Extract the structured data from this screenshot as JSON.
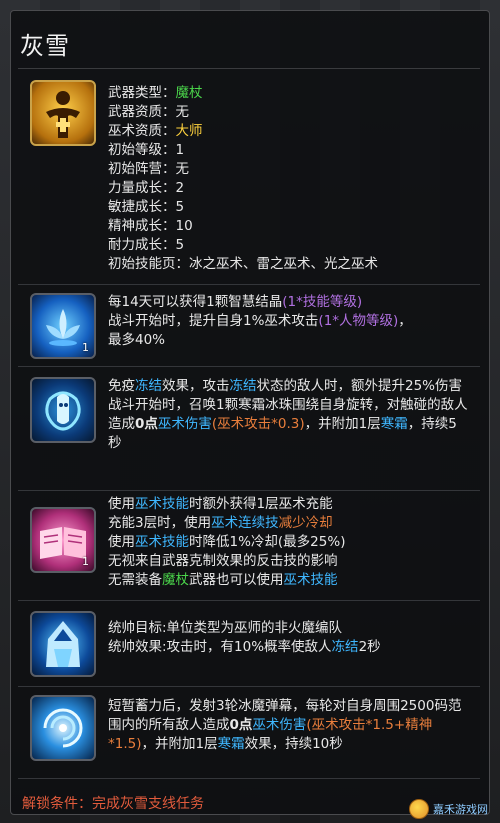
{
  "header": {
    "title": "灰雪"
  },
  "hero": {
    "weapon_type_label": "武器类型：",
    "weapon_type_value": "魔杖",
    "weapon_aptitude_label": "武器资质：",
    "weapon_aptitude_value": "无",
    "sorcery_aptitude_label": "巫术资质：",
    "sorcery_aptitude_value": "大师",
    "initial_level_label": "初始等级：",
    "initial_level_value": "1",
    "initial_camp_label": "初始阵营：",
    "initial_camp_value": "无",
    "strength_growth_label": "力量成长：",
    "strength_growth_value": "2",
    "agility_growth_label": "敏捷成长：",
    "agility_growth_value": "5",
    "spirit_growth_label": "精神成长：",
    "spirit_growth_value": "10",
    "stamina_growth_label": "耐力成长：",
    "stamina_growth_value": "5",
    "initial_skills_label": "初始技能页：",
    "initial_skills_value": "冰之巫术、雷之巫术、光之巫术"
  },
  "skills": [
    {
      "icon": "ice-lotus-icon",
      "level": "1",
      "line1_a": "每14天可以获得1颗智慧结晶",
      "line1_b": "(1*技能等级)",
      "line2_a": "战斗开始时，提升自身1%巫术攻击",
      "line2_b": "(1*人物等级)",
      "line2_c": "，",
      "line3": "最多40%"
    },
    {
      "icon": "frost-orb-icon",
      "p1": "免疫",
      "p2": "冻结",
      "p3": "效果，攻击",
      "p4": "冻结",
      "p5": "状态的敌人时，额外提升25%伤害",
      "p6": "战斗开始时，召唤1颗寒霜冰珠围绕自身旋转，对触碰的敌人造成",
      "p7": "0点",
      "p8": "巫术伤害",
      "p9": "(巫术攻击*0.3)",
      "p10": "，并附加1层",
      "p11": "寒霜",
      "p12": "，持续5秒"
    },
    {
      "icon": "spellbook-icon",
      "level": "1",
      "line1_a": "使用",
      "line1_b": "巫术技能",
      "line1_c": "时额外获得1层巫术充能",
      "line2_a": "充能3层时，使用",
      "line2_b": "巫术连续技",
      "line2_c": "减少冷却",
      "line3_a": "使用",
      "line3_b": "巫术技能",
      "line3_c": "时降低1%冷却(最多25%)",
      "line4": "无视来自武器克制效果的反击技的影响",
      "line5_a": "无需装备",
      "line5_b": "魔杖",
      "line5_c": "武器也可以使用",
      "line5_d": "巫术技能"
    },
    {
      "icon": "ice-mage-icon",
      "line1": "统帅目标:单位类型为巫师的非火魔编队",
      "line2_a": "统帅效果:攻击时，有10%概率使敌人",
      "line2_b": "冻结",
      "line2_c": "2秒"
    },
    {
      "icon": "ice-vortex-icon",
      "p1": "短暂蓄力后，发射3轮冰魔弹幕，每轮对自身周围2500码范围内的所有敌人造成",
      "p2": "0点",
      "p3": "巫术伤害",
      "p4": "(巫术攻击*1.5+精神*1.5)",
      "p5": "，并附加1层",
      "p6": "寒霜",
      "p7": "效果，持续10秒"
    }
  ],
  "footer": {
    "unlock_label": "解锁条件：完成灰雪支线任务",
    "watermark": "嘉禾游戏网"
  },
  "colors": {
    "green": "#4bd64b",
    "gold": "#ffd23d",
    "cyan": "#3fb7ff",
    "orange": "#e87e3c",
    "purple": "#b070e0",
    "unlock": "#e25b3c"
  }
}
